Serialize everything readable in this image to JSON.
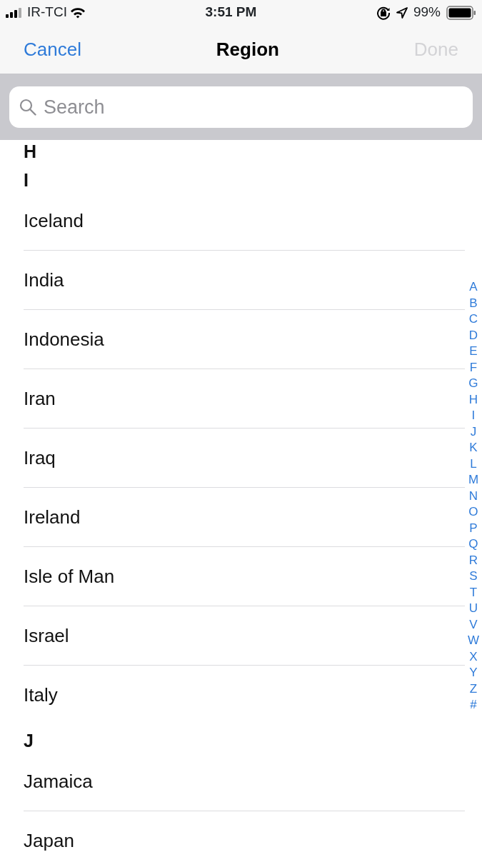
{
  "status_bar": {
    "carrier": "IR-TCI",
    "time": "3:51 PM",
    "battery": "99%"
  },
  "nav": {
    "cancel": "Cancel",
    "title": "Region",
    "done": {
      "label": "Done",
      "disabled": true
    }
  },
  "search": {
    "placeholder": "Search"
  },
  "sections": [
    {
      "letter": "H"
    },
    {
      "letter": "I",
      "items": [
        {
          "name": "Iceland"
        },
        {
          "name": "India"
        },
        {
          "name": "Indonesia"
        },
        {
          "name": "Iran"
        },
        {
          "name": "Iraq"
        },
        {
          "name": "Ireland"
        },
        {
          "name": "Isle of Man"
        },
        {
          "name": "Israel"
        },
        {
          "name": "Italy"
        }
      ]
    },
    {
      "letter": "J",
      "items": [
        {
          "name": "Jamaica"
        },
        {
          "name": "Japan"
        }
      ]
    }
  ],
  "index": [
    "A",
    "B",
    "C",
    "D",
    "E",
    "F",
    "G",
    "H",
    "I",
    "J",
    "K",
    "L",
    "M",
    "N",
    "O",
    "P",
    "Q",
    "R",
    "S",
    "T",
    "U",
    "V",
    "W",
    "X",
    "Y",
    "Z",
    "#"
  ]
}
